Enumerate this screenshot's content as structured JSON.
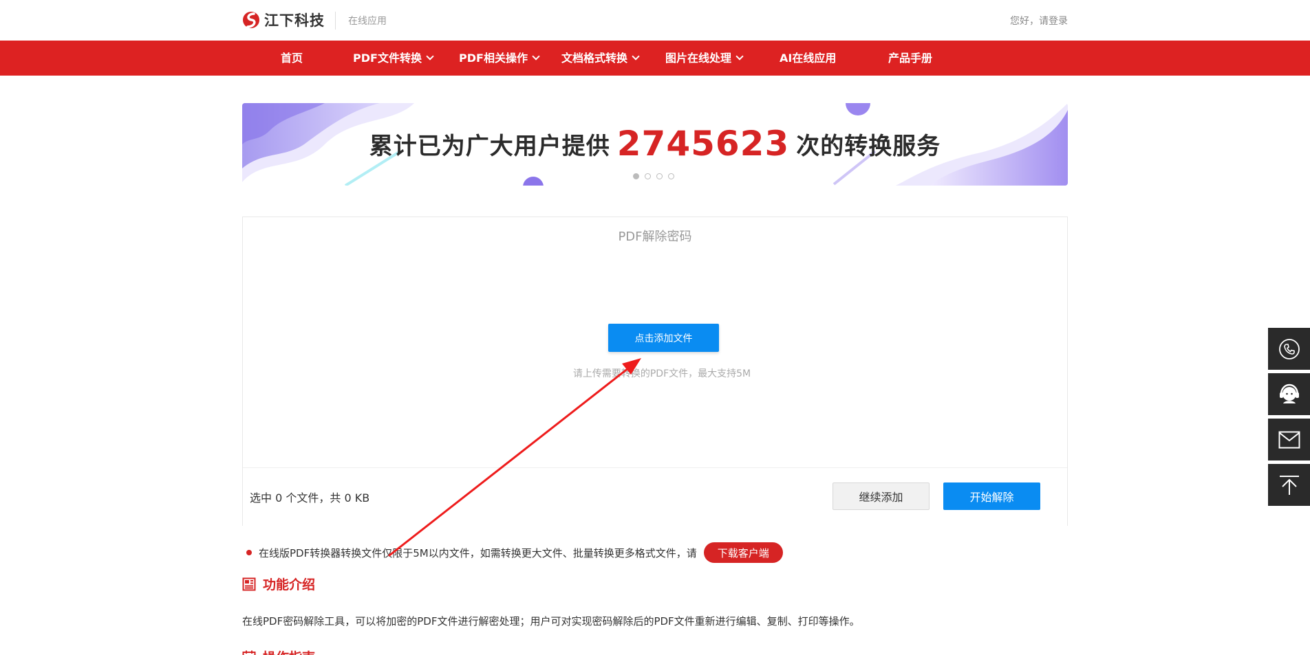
{
  "header": {
    "logo_text": "江下科技",
    "subtitle": "在线应用",
    "login_text": "您好，请登录"
  },
  "nav": {
    "items": [
      {
        "label": "首页",
        "has_dropdown": false
      },
      {
        "label": "PDF文件转换",
        "has_dropdown": true
      },
      {
        "label": "PDF相关操作",
        "has_dropdown": true
      },
      {
        "label": "文档格式转换",
        "has_dropdown": true
      },
      {
        "label": "图片在线处理",
        "has_dropdown": true
      },
      {
        "label": "AI在线应用",
        "has_dropdown": false
      },
      {
        "label": "产品手册",
        "has_dropdown": false
      }
    ]
  },
  "banner": {
    "text_before": "累计已为广大用户提供",
    "count": "2745623",
    "text_after": "次的转换服务",
    "slide_count": 4,
    "active_slide": 1
  },
  "tool": {
    "title": "PDF解除密码",
    "add_button": "点击添加文件",
    "upload_hint": "请上传需要转换的PDF文件，最大支持5M",
    "selection_info": "选中 0 个文件，共 0 KB",
    "continue_button": "继续添加",
    "start_button": "开始解除"
  },
  "notice": {
    "text": "在线版PDF转换器转换文件仅限于5M以内文件，如需转换更大文件、批量转换更多格式文件，请",
    "download_button": "下载客户端"
  },
  "intro": {
    "title": "功能介绍",
    "text": "在线PDF密码解除工具，可以将加密的PDF文件进行解密处理；用户可对实现密码解除后的PDF文件重新进行编辑、复制、打印等操作。"
  },
  "guide": {
    "title": "操作指南"
  },
  "side_tools": [
    {
      "icon": "phone-icon"
    },
    {
      "icon": "customer-service-icon"
    },
    {
      "icon": "mail-icon"
    },
    {
      "icon": "back-to-top-icon"
    }
  ],
  "colors": {
    "brand_red": "#dd2222",
    "accent_blue": "#0a8cf2",
    "side_bg": "#2a2a2a"
  }
}
